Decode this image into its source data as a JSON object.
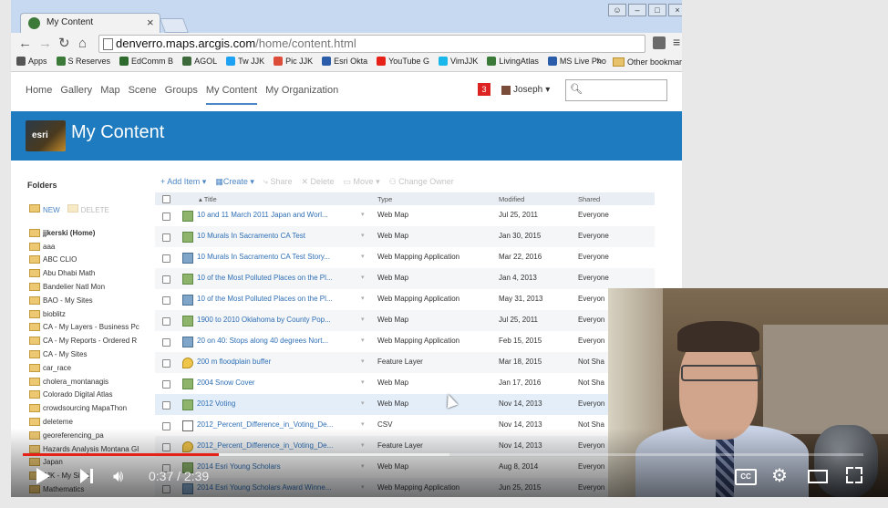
{
  "browser": {
    "tab_title": "My Content",
    "tab_close": "×",
    "url_host": "denverro.maps.arcgis.com",
    "url_path": "/home/content.html",
    "bookmarks": [
      {
        "label": "Apps",
        "color": "#555555"
      },
      {
        "label": "S Reserves",
        "color": "#3c7a3a"
      },
      {
        "label": "EdComm B",
        "color": "#2f6b2f"
      },
      {
        "label": "AGOL",
        "color": "#3c6a3a"
      },
      {
        "label": "Tw JJK",
        "color": "#1da1f2"
      },
      {
        "label": "Pic JJK",
        "color": "#dd4b39"
      },
      {
        "label": "Esri Okta",
        "color": "#2a5caa"
      },
      {
        "label": "YouTube G",
        "color": "#e62117"
      },
      {
        "label": "VimJJK",
        "color": "#1ab7ea"
      },
      {
        "label": "LivingAtlas",
        "color": "#3c7a3a"
      },
      {
        "label": "MS Live Pho",
        "color": "#2a5caa"
      }
    ],
    "bookmarks_more": "»",
    "other_bookmarks": "Other bookmark"
  },
  "agol": {
    "nav": [
      "Home",
      "Gallery",
      "Map",
      "Scene",
      "Groups",
      "My Content",
      "My Organization"
    ],
    "active_nav": "My Content",
    "notifications": "3",
    "user": "Joseph",
    "banner_logo": "esri",
    "banner_title": "My Content",
    "folders_title": "Folders",
    "folder_new": "NEW",
    "folder_delete": "DELETE",
    "folders": [
      "jjkerski (Home)",
      "aaa",
      "ABC CLIO",
      "Abu Dhabi Math",
      "Bandelier Natl Mon",
      "BAO - My Sites",
      "bioblitz",
      "CA - My Layers - Business Pc",
      "CA - My Reports - Ordered R",
      "CA - My Sites",
      "car_race",
      "cholera_montanagis",
      "Colorado Digital Atlas",
      "crowdsourcing MapaThon",
      "deleteme",
      "georeferencing_pa",
      "Hazards Analysis Montana GI",
      "Japan",
      "JJK - My Sites",
      "Mathematics"
    ],
    "actions": {
      "add_item": "Add Item",
      "create": "Create",
      "share": "Share",
      "delete": "Delete",
      "move": "Move",
      "change_owner": "Change Owner"
    },
    "columns": {
      "title": "Title",
      "type": "Type",
      "modified": "Modified",
      "shared": "Shared"
    },
    "items": [
      {
        "title": "10 and 11 March 2011 Japan and Worl...",
        "type": "Web Map",
        "modified": "Jul 25, 2011",
        "shared": "Everyone",
        "kind": "map"
      },
      {
        "title": "10 Murals In Sacramento CA Test",
        "type": "Web Map",
        "modified": "Jan 30, 2015",
        "shared": "Everyone",
        "kind": "map"
      },
      {
        "title": "10 Murals In Sacramento CA Test Story...",
        "type": "Web Mapping Application",
        "modified": "Mar 22, 2016",
        "shared": "Everyone",
        "kind": "app"
      },
      {
        "title": "10 of the Most Polluted Places on the Pl...",
        "type": "Web Map",
        "modified": "Jan 4, 2013",
        "shared": "Everyone",
        "kind": "map"
      },
      {
        "title": "10 of the Most Polluted Places on the Pl...",
        "type": "Web Mapping Application",
        "modified": "May 31, 2013",
        "shared": "Everyon",
        "kind": "app"
      },
      {
        "title": "1900 to 2010 Oklahoma by County Pop...",
        "type": "Web Map",
        "modified": "Jul 25, 2011",
        "shared": "Everyon",
        "kind": "map"
      },
      {
        "title": "20 on 40: Stops along 40 degrees Nort...",
        "type": "Web Mapping Application",
        "modified": "Feb 15, 2015",
        "shared": "Everyon",
        "kind": "app"
      },
      {
        "title": "200 m floodplain buffer",
        "type": "Feature Layer",
        "modified": "Mar 18, 2015",
        "shared": "Not Sha",
        "kind": "feature"
      },
      {
        "title": "2004 Snow Cover",
        "type": "Web Map",
        "modified": "Jan 17, 2016",
        "shared": "Not Sha",
        "kind": "map"
      },
      {
        "title": "2012 Voting",
        "type": "Web Map",
        "modified": "Nov 14, 2013",
        "shared": "Everyon",
        "kind": "map"
      },
      {
        "title": "2012_Percent_Difference_in_Voting_De...",
        "type": "CSV",
        "modified": "Nov 14, 2013",
        "shared": "Not Sha",
        "kind": "csv"
      },
      {
        "title": "2012_Percent_Difference_in_Voting_De...",
        "type": "Feature Layer",
        "modified": "Nov 14, 2013",
        "shared": "Everyon",
        "kind": "feature"
      },
      {
        "title": "2014 Esri Young Scholars",
        "type": "Web Map",
        "modified": "Aug 8, 2014",
        "shared": "Everyon",
        "kind": "map"
      },
      {
        "title": "2014 Esri Young Scholars Award Winne...",
        "type": "Web Mapping Application",
        "modified": "Jun 25, 2015",
        "shared": "Everyon",
        "kind": "app"
      }
    ],
    "highlighted_row": 9
  },
  "player": {
    "current_time": "0:37",
    "duration": "2:39",
    "played_fraction": 0.233,
    "loaded_fraction": 0.508,
    "cc_label": "CC"
  },
  "colors": {
    "accent": "#1f7bbf",
    "link": "#2f6fb5",
    "progress": "#e62117"
  }
}
